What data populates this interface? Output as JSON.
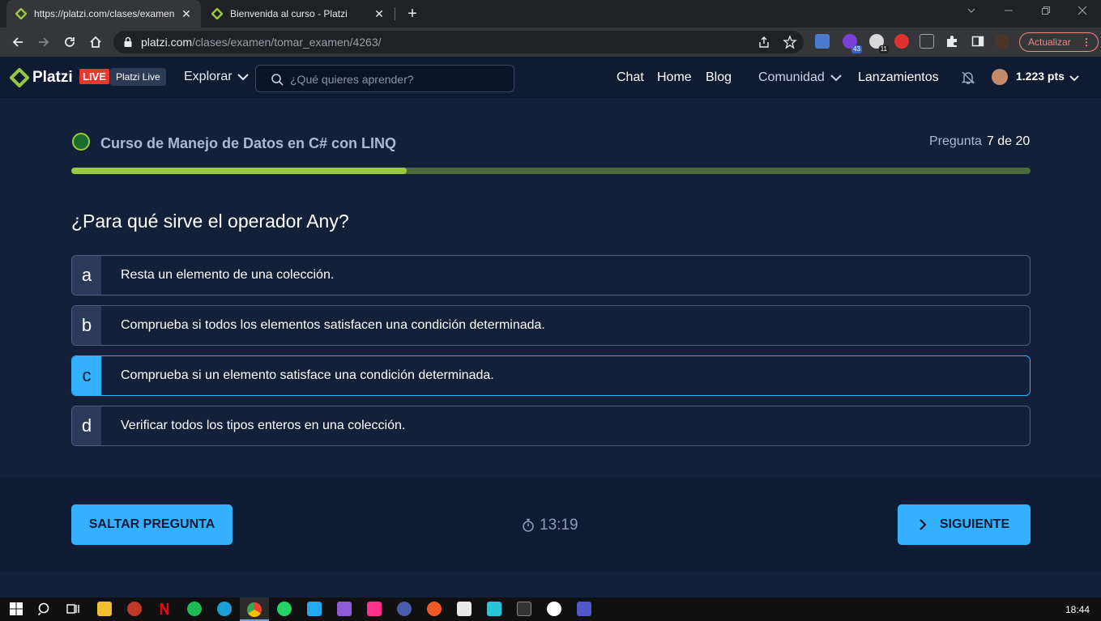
{
  "browser": {
    "tabs": [
      {
        "title": "https://platzi.com/clases/examen",
        "active": true
      },
      {
        "title": "Bienvenida al curso - Platzi",
        "active": false
      }
    ],
    "close_glyph": "✕",
    "new_tab_glyph": "+",
    "url_host": "platzi.com",
    "url_path": "/clases/examen/tomar_examen/4263/",
    "extension_badges": [
      "43",
      "11"
    ],
    "update_label": "Actualizar",
    "update_menu_glyph": "⋮"
  },
  "header": {
    "logo_text": "Platzi",
    "live_badge": "LIVE",
    "platzi_live_label": "Platzi Live",
    "explorar_label": "Explorar",
    "search_placeholder": "¿Qué quieres aprender?",
    "nav": [
      "Chat",
      "Home",
      "Blog"
    ],
    "comunidad_label": "Comunidad",
    "lanzamientos_label": "Lanzamientos",
    "points": "1.223 pts"
  },
  "exam": {
    "course_title": "Curso de Manejo de Datos en C# con LINQ",
    "question_label": "Pregunta",
    "question_counter": "7 de 20",
    "progress_fraction": 0.35,
    "question": "¿Para qué sirve el operador Any?",
    "options": [
      {
        "letter": "a",
        "text": "Resta un elemento de una colección.",
        "selected": false
      },
      {
        "letter": "b",
        "text": "Comprueba si todos los elementos satisfacen una condición determinada.",
        "selected": false
      },
      {
        "letter": "c",
        "text": "Comprueba si un elemento satisface una condición determinada.",
        "selected": true
      },
      {
        "letter": "d",
        "text": "Verificar todos los tipos enteros en una colección.",
        "selected": false
      }
    ]
  },
  "footer": {
    "skip_label": "SALTAR PREGUNTA",
    "timer": "13:19",
    "next_label": "SIGUIENTE"
  },
  "taskbar": {
    "clock": "18:44"
  },
  "colors": {
    "accent": "#33b1ff",
    "progress": "#98ca3f",
    "background": "#13203a"
  }
}
